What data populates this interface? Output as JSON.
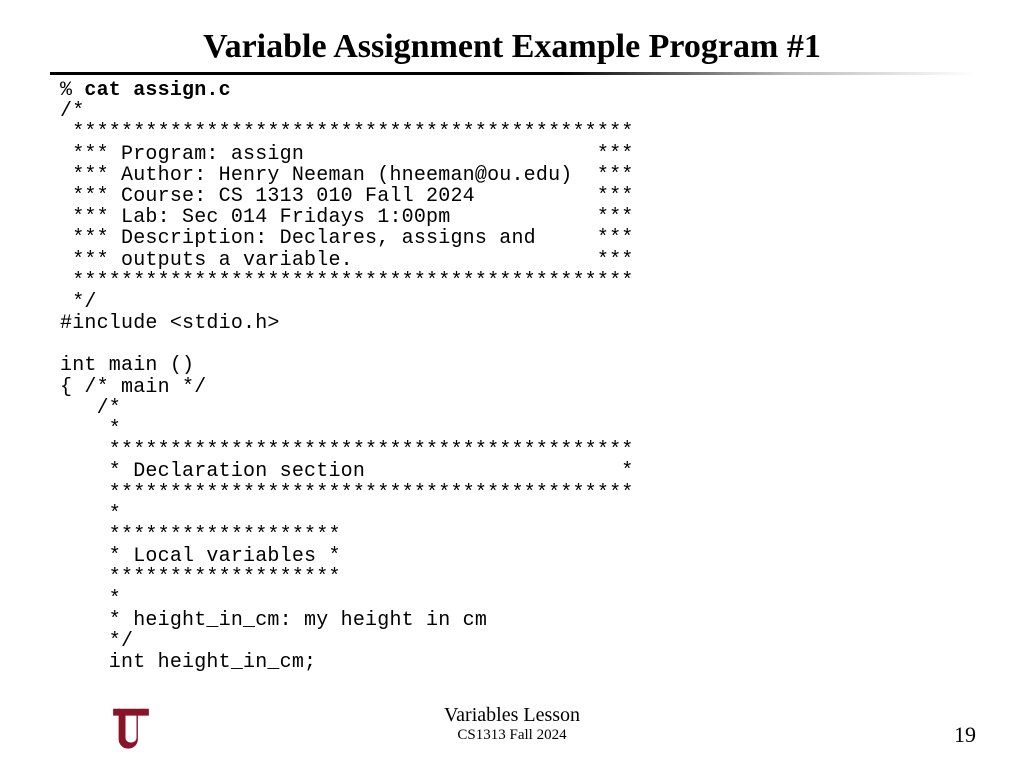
{
  "title": "Variable Assignment Example Program #1",
  "code": {
    "prompt": "% ",
    "command": "cat assign.c",
    "lines": [
      "/*",
      " **********************************************",
      " *** Program: assign                        ***",
      " *** Author: Henry Neeman (hneeman@ou.edu)  ***",
      " *** Course: CS 1313 010 Fall 2024          ***",
      " *** Lab: Sec 014 Fridays 1:00pm            ***",
      " *** Description: Declares, assigns and     ***",
      " *** outputs a variable.                    ***",
      " **********************************************",
      " */",
      "#include <stdio.h>",
      "",
      "int main ()",
      "{ /* main */",
      "   /*",
      "    *",
      "    *******************************************",
      "    * Declaration section                     *",
      "    *******************************************",
      "    *",
      "    *******************",
      "    * Local variables *",
      "    *******************",
      "    *",
      "    * height_in_cm: my height in cm",
      "    */",
      "    int height_in_cm;"
    ]
  },
  "footer": {
    "lesson": "Variables Lesson",
    "course": "CS1313 Fall 2024",
    "page": "19"
  },
  "logo": {
    "color": "#8a1427"
  }
}
